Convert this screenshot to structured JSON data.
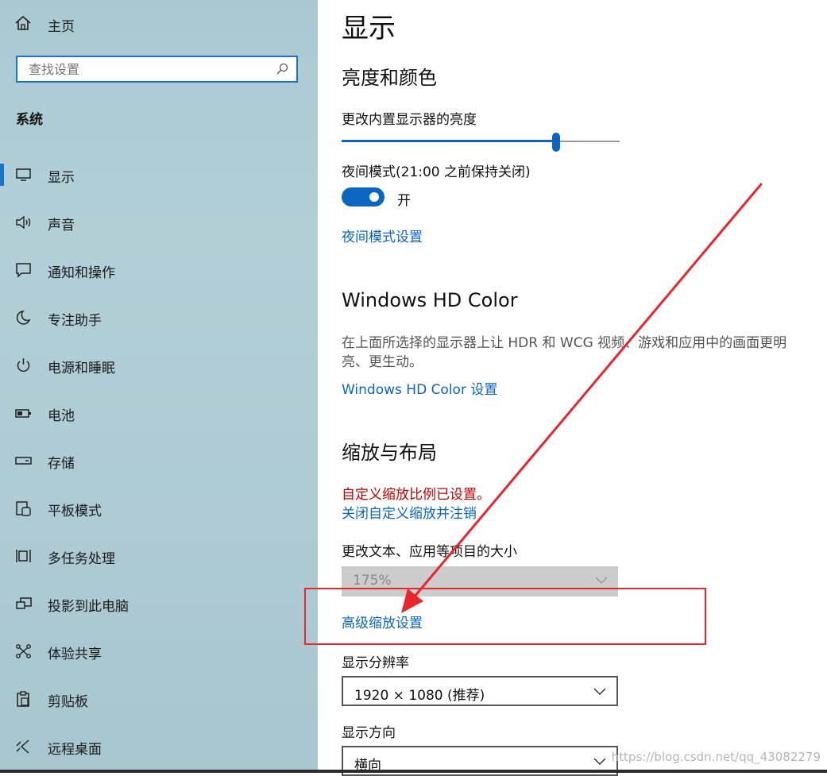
{
  "sidebar": {
    "home_label": "主页",
    "search_placeholder": "查找设置",
    "section_title": "系统",
    "items": [
      {
        "label": "显示",
        "icon": "monitor-icon",
        "selected": true
      },
      {
        "label": "声音",
        "icon": "speaker-icon"
      },
      {
        "label": "通知和操作",
        "icon": "notification-icon"
      },
      {
        "label": "专注助手",
        "icon": "moon-icon"
      },
      {
        "label": "电源和睡眠",
        "icon": "power-icon"
      },
      {
        "label": "电池",
        "icon": "battery-icon"
      },
      {
        "label": "存储",
        "icon": "storage-icon"
      },
      {
        "label": "平板模式",
        "icon": "tablet-icon"
      },
      {
        "label": "多任务处理",
        "icon": "multitasking-icon"
      },
      {
        "label": "投影到此电脑",
        "icon": "project-icon"
      },
      {
        "label": "体验共享",
        "icon": "share-icon"
      },
      {
        "label": "剪贴板",
        "icon": "clipboard-icon"
      },
      {
        "label": "远程桌面",
        "icon": "remote-desktop-icon"
      }
    ]
  },
  "main": {
    "title": "显示",
    "brightness_section": {
      "heading": "亮度和颜色",
      "brightness_label": "更改内置显示器的亮度",
      "brightness_value": 0.77,
      "night_mode_label": "夜间模式(21:00 之前保持关闭)",
      "night_mode_on": true,
      "night_mode_state": "开",
      "night_mode_link": "夜间模式设置"
    },
    "hd_color_section": {
      "heading": "Windows HD Color",
      "description": "在上面所选择的显示器上让 HDR 和 WCG 视频、游戏和应用中的画面更明亮、更生动。",
      "link": "Windows HD Color 设置"
    },
    "scale_section": {
      "heading": "缩放与布局",
      "custom_scale_warning": "自定义缩放比例已设置。",
      "turn_off_custom_link": "关闭自定义缩放并注销",
      "scale_label": "更改文本、应用等项目的大小",
      "scale_value": "175%",
      "advanced_link": "高级缩放设置",
      "resolution_label": "显示分辨率",
      "resolution_value": "1920 × 1080 (推荐)",
      "orientation_label": "显示方向",
      "orientation_value": "横向"
    }
  },
  "watermark": "https://blog.csdn.net/qq_43082279",
  "colors": {
    "accent": "#0a66c2",
    "warning": "#c40000",
    "annotation": "#e8262e",
    "sidebar_bg": "#aecbd3"
  }
}
